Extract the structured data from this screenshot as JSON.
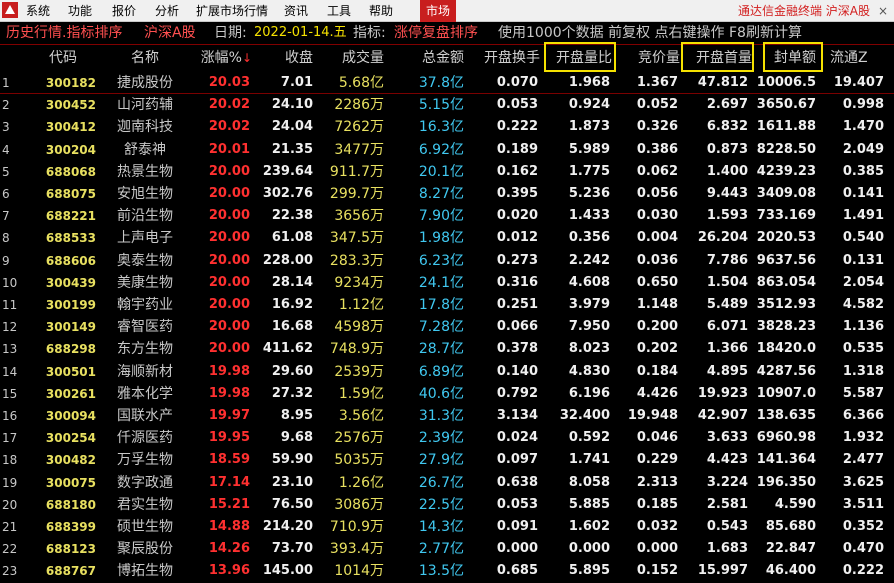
{
  "menubar": {
    "items": [
      "系统",
      "功能",
      "报价",
      "分析",
      "扩展市场行情",
      "资讯",
      "工具",
      "帮助"
    ],
    "market_button": "市场",
    "right_title": "通达信金融终端  沪深A股",
    "close": "×"
  },
  "infobar": {
    "title": "历史行情.指标排序",
    "market": "沪深A股",
    "date_label": "日期:",
    "date": "2022-01-14.五",
    "indicator_label": "指标:",
    "indicator": "涨停复盘排序",
    "note": "使用1000个数据 前复权 点右键操作 F8刷新计算"
  },
  "table": {
    "headers": {
      "code": "代码",
      "name": "名称",
      "chg": "涨幅%",
      "price": "收盘",
      "vol": "成交量",
      "amt": "总金额",
      "turn": "开盘换手",
      "ratio": "开盘量比",
      "bidp": "竞价量",
      "first": "开盘首量",
      "seal": "封单额",
      "float": "流通Z"
    },
    "rows": [
      {
        "idx": "1",
        "code": "300182",
        "name": "捷成股份",
        "chg": "20.03",
        "price": "7.01",
        "vol": "5.68亿",
        "amt": "37.8亿",
        "turn": "0.070",
        "ratio": "1.968",
        "bidp": "1.367",
        "first": "47.812",
        "seal": "10006.5",
        "float": "19.407"
      },
      {
        "idx": "2",
        "code": "300452",
        "name": "山河药辅",
        "chg": "20.02",
        "price": "24.10",
        "vol": "2286万",
        "amt": "5.15亿",
        "turn": "0.053",
        "ratio": "0.924",
        "bidp": "0.052",
        "first": "2.697",
        "seal": "3650.67",
        "float": "0.998"
      },
      {
        "idx": "3",
        "code": "300412",
        "name": "迦南科技",
        "chg": "20.02",
        "price": "24.04",
        "vol": "7262万",
        "amt": "16.3亿",
        "turn": "0.222",
        "ratio": "1.873",
        "bidp": "0.326",
        "first": "6.832",
        "seal": "1611.88",
        "float": "1.470"
      },
      {
        "idx": "4",
        "code": "300204",
        "name": "舒泰神",
        "chg": "20.01",
        "price": "21.35",
        "vol": "3477万",
        "amt": "6.92亿",
        "turn": "0.189",
        "ratio": "5.989",
        "bidp": "0.386",
        "first": "0.873",
        "seal": "8228.50",
        "float": "2.049"
      },
      {
        "idx": "5",
        "code": "688068",
        "name": "热景生物",
        "chg": "20.00",
        "price": "239.64",
        "vol": "911.7万",
        "amt": "20.1亿",
        "turn": "0.162",
        "ratio": "1.775",
        "bidp": "0.062",
        "first": "1.400",
        "seal": "4239.23",
        "float": "0.385"
      },
      {
        "idx": "6",
        "code": "688075",
        "name": "安旭生物",
        "chg": "20.00",
        "price": "302.76",
        "vol": "299.7万",
        "amt": "8.27亿",
        "turn": "0.395",
        "ratio": "5.236",
        "bidp": "0.056",
        "first": "9.443",
        "seal": "3409.08",
        "float": "0.141"
      },
      {
        "idx": "7",
        "code": "688221",
        "name": "前沿生物",
        "chg": "20.00",
        "price": "22.38",
        "vol": "3656万",
        "amt": "7.90亿",
        "turn": "0.020",
        "ratio": "1.433",
        "bidp": "0.030",
        "first": "1.593",
        "seal": "733.169",
        "float": "1.491"
      },
      {
        "idx": "8",
        "code": "688533",
        "name": "上声电子",
        "chg": "20.00",
        "price": "61.08",
        "vol": "347.5万",
        "amt": "1.98亿",
        "turn": "0.012",
        "ratio": "0.356",
        "bidp": "0.004",
        "first": "26.204",
        "seal": "2020.53",
        "float": "0.540"
      },
      {
        "idx": "9",
        "code": "688606",
        "name": "奥泰生物",
        "chg": "20.00",
        "price": "228.00",
        "vol": "283.3万",
        "amt": "6.23亿",
        "turn": "0.273",
        "ratio": "2.242",
        "bidp": "0.036",
        "first": "7.786",
        "seal": "9637.56",
        "float": "0.131"
      },
      {
        "idx": "10",
        "code": "300439",
        "name": "美康生物",
        "chg": "20.00",
        "price": "28.14",
        "vol": "9234万",
        "amt": "24.1亿",
        "turn": "0.316",
        "ratio": "4.608",
        "bidp": "0.650",
        "first": "1.504",
        "seal": "863.054",
        "float": "2.054"
      },
      {
        "idx": "11",
        "code": "300199",
        "name": "翰宇药业",
        "chg": "20.00",
        "price": "16.92",
        "vol": "1.12亿",
        "amt": "17.8亿",
        "turn": "0.251",
        "ratio": "3.979",
        "bidp": "1.148",
        "first": "5.489",
        "seal": "3512.93",
        "float": "4.582"
      },
      {
        "idx": "12",
        "code": "300149",
        "name": "睿智医药",
        "chg": "20.00",
        "price": "16.68",
        "vol": "4598万",
        "amt": "7.28亿",
        "turn": "0.066",
        "ratio": "7.950",
        "bidp": "0.200",
        "first": "6.071",
        "seal": "3828.23",
        "float": "1.136"
      },
      {
        "idx": "13",
        "code": "688298",
        "name": "东方生物",
        "chg": "20.00",
        "price": "411.62",
        "vol": "748.9万",
        "amt": "28.7亿",
        "turn": "0.378",
        "ratio": "8.023",
        "bidp": "0.202",
        "first": "1.366",
        "seal": "18420.0",
        "float": "0.535"
      },
      {
        "idx": "14",
        "code": "300501",
        "name": "海顺新材",
        "chg": "19.98",
        "price": "29.60",
        "vol": "2539万",
        "amt": "6.89亿",
        "turn": "0.140",
        "ratio": "4.830",
        "bidp": "0.184",
        "first": "4.895",
        "seal": "4287.56",
        "float": "1.318"
      },
      {
        "idx": "15",
        "code": "300261",
        "name": "雅本化学",
        "chg": "19.98",
        "price": "27.32",
        "vol": "1.59亿",
        "amt": "40.6亿",
        "turn": "0.792",
        "ratio": "6.196",
        "bidp": "4.426",
        "first": "19.923",
        "seal": "10907.0",
        "float": "5.587"
      },
      {
        "idx": "16",
        "code": "300094",
        "name": "国联水产",
        "chg": "19.97",
        "price": "8.95",
        "vol": "3.56亿",
        "amt": "31.3亿",
        "turn": "3.134",
        "ratio": "32.400",
        "bidp": "19.948",
        "first": "42.907",
        "seal": "138.635",
        "float": "6.366"
      },
      {
        "idx": "17",
        "code": "300254",
        "name": "仟源医药",
        "chg": "19.95",
        "price": "9.68",
        "vol": "2576万",
        "amt": "2.39亿",
        "turn": "0.024",
        "ratio": "0.592",
        "bidp": "0.046",
        "first": "3.633",
        "seal": "6960.98",
        "float": "1.932"
      },
      {
        "idx": "18",
        "code": "300482",
        "name": "万孚生物",
        "chg": "18.59",
        "price": "59.90",
        "vol": "5035万",
        "amt": "27.9亿",
        "turn": "0.097",
        "ratio": "1.741",
        "bidp": "0.229",
        "first": "4.423",
        "seal": "141.364",
        "float": "2.477"
      },
      {
        "idx": "19",
        "code": "300075",
        "name": "数字政通",
        "chg": "17.14",
        "price": "23.10",
        "vol": "1.26亿",
        "amt": "26.7亿",
        "turn": "0.638",
        "ratio": "8.058",
        "bidp": "2.313",
        "first": "3.224",
        "seal": "196.350",
        "float": "3.625"
      },
      {
        "idx": "20",
        "code": "688180",
        "name": "君实生物",
        "chg": "15.21",
        "price": "76.50",
        "vol": "3086万",
        "amt": "22.5亿",
        "turn": "0.053",
        "ratio": "5.885",
        "bidp": "0.185",
        "first": "2.581",
        "seal": "4.590",
        "float": "3.511"
      },
      {
        "idx": "21",
        "code": "688399",
        "name": "硕世生物",
        "chg": "14.88",
        "price": "214.20",
        "vol": "710.9万",
        "amt": "14.3亿",
        "turn": "0.091",
        "ratio": "1.602",
        "bidp": "0.032",
        "first": "0.543",
        "seal": "85.680",
        "float": "0.352"
      },
      {
        "idx": "22",
        "code": "688123",
        "name": "聚辰股份",
        "chg": "14.26",
        "price": "73.70",
        "vol": "393.4万",
        "amt": "2.77亿",
        "turn": "0.000",
        "ratio": "0.000",
        "bidp": "0.000",
        "first": "1.683",
        "seal": "22.847",
        "float": "0.470"
      },
      {
        "idx": "23",
        "code": "688767",
        "name": "博拓生物",
        "chg": "13.96",
        "price": "145.00",
        "vol": "1014万",
        "amt": "13.5亿",
        "turn": "0.685",
        "ratio": "5.895",
        "bidp": "0.152",
        "first": "15.997",
        "seal": "46.400",
        "float": "0.222"
      }
    ]
  }
}
